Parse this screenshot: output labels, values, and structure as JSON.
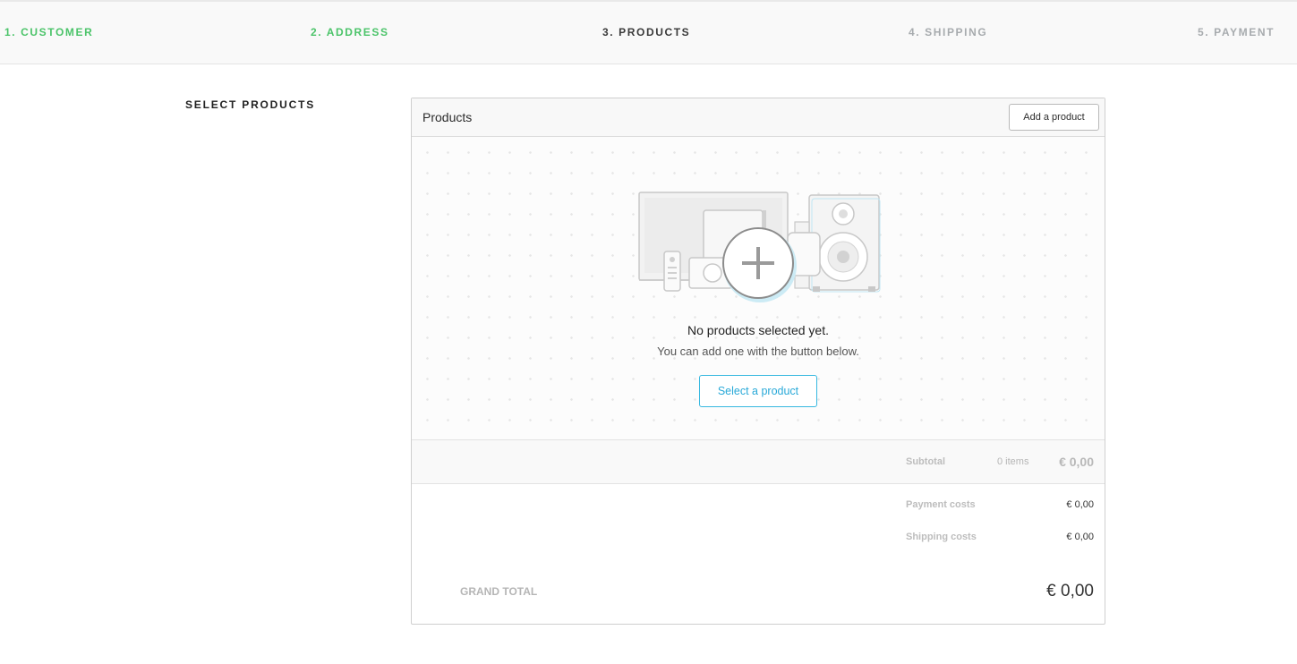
{
  "stepper": {
    "steps": [
      {
        "label": "1. CUSTOMER",
        "state": "done"
      },
      {
        "label": "2. ADDRESS",
        "state": "done"
      },
      {
        "label": "3. PRODUCTS",
        "state": "active"
      },
      {
        "label": "4. SHIPPING",
        "state": "todo"
      },
      {
        "label": "5. PAYMENT",
        "state": "todo"
      }
    ],
    "colors": {
      "done": "#4cc46a",
      "active": "#3a3a3a",
      "todo": "#a7abae"
    }
  },
  "section": {
    "title": "SELECT PRODUCTS"
  },
  "panel": {
    "title": "Products",
    "add_button_label": "Add a product",
    "empty_title": "No products selected yet.",
    "empty_subtitle": "You can add one with the button below.",
    "select_button_label": "Select a product",
    "illustration_icon": "products-plus-illustration",
    "accent_color": "#37b8e0"
  },
  "totals": {
    "subtotal_label": "Subtotal",
    "subtotal_items": "0 items",
    "subtotal_amount": "€ 0,00",
    "payment_costs_label": "Payment costs",
    "payment_costs_amount": "€ 0,00",
    "shipping_costs_label": "Shipping costs",
    "shipping_costs_amount": "€ 0,00",
    "grand_total_label": "GRAND TOTAL",
    "grand_total_amount": "€ 0,00"
  }
}
